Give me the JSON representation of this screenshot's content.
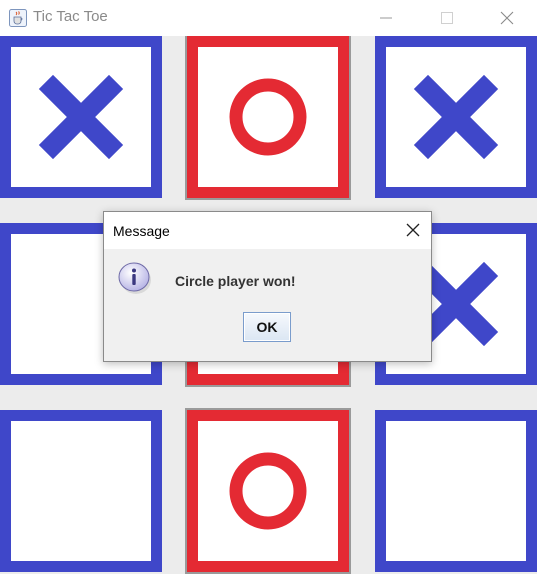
{
  "window": {
    "title": "Tic Tac Toe",
    "controls": [
      "minimize",
      "maximize",
      "close"
    ]
  },
  "board": {
    "cells": [
      {
        "row": 1,
        "col": 1,
        "mark": "X",
        "highlighted": false
      },
      {
        "row": 1,
        "col": 2,
        "mark": "O",
        "highlighted": true
      },
      {
        "row": 1,
        "col": 3,
        "mark": "X",
        "highlighted": false
      },
      {
        "row": 2,
        "col": 1,
        "mark": "",
        "highlighted": false
      },
      {
        "row": 2,
        "col": 2,
        "mark": "O",
        "highlighted": true
      },
      {
        "row": 2,
        "col": 3,
        "mark": "X",
        "highlighted": false
      },
      {
        "row": 3,
        "col": 1,
        "mark": "",
        "highlighted": false
      },
      {
        "row": 3,
        "col": 2,
        "mark": "O",
        "highlighted": true
      },
      {
        "row": 3,
        "col": 3,
        "mark": "",
        "highlighted": false
      }
    ]
  },
  "dialog": {
    "title": "Message",
    "message": "Circle player won!",
    "ok_label": "OK",
    "icon": "info-icon"
  },
  "colors": {
    "x_player": "#3f47c9",
    "o_player": "#e42a33",
    "board_background": "#ececec"
  }
}
